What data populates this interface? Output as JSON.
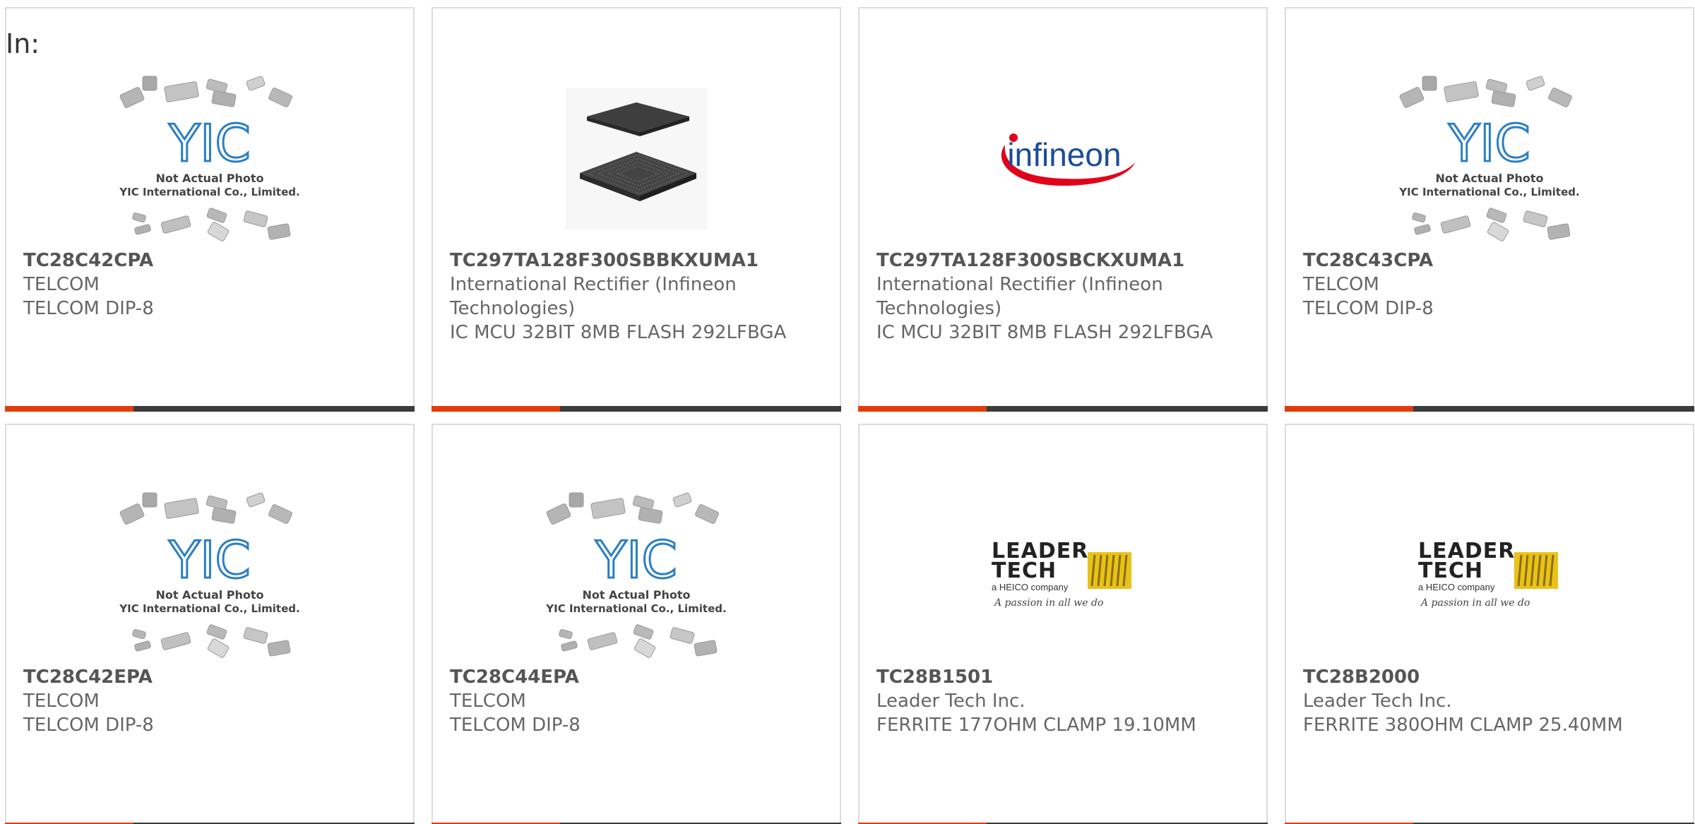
{
  "filter": {
    "label": "In:"
  },
  "colors": {
    "accent": "#e63a0a",
    "bar_dark": "#3b3b3b",
    "border": "#dcdcdc",
    "yic_blue": "#2a7fc4",
    "infineon_red": "#e2001a",
    "infineon_blue": "#1b4b9b",
    "leader_yellow": "#e8c21a"
  },
  "placeholder_logo": {
    "brand": "YIC",
    "line1": "Not Actual Photo",
    "line2": "YIC International Co., Limited."
  },
  "infineon_logo": {
    "text": "infineon"
  },
  "leader_logo": {
    "line1": "LEADER",
    "line2": "TECH",
    "line3": "a HEICO company",
    "tagline": "A passion in all we do"
  },
  "products": [
    {
      "part_number": "TC28C42CPA",
      "manufacturer": "TELCOM",
      "description": "TELCOM DIP-8",
      "image": "yic-placeholder"
    },
    {
      "part_number": "TC297TA128F300SBBKXUMA1",
      "manufacturer": "International Rectifier (Infineon Technologies)",
      "description": "IC MCU 32BIT 8MB FLASH 292LFBGA",
      "image": "bga-chip"
    },
    {
      "part_number": "TC297TA128F300SBCKXUMA1",
      "manufacturer": "International Rectifier (Infineon Technologies)",
      "description": "IC MCU 32BIT 8MB FLASH 292LFBGA",
      "image": "infineon-logo"
    },
    {
      "part_number": "TC28C43CPA",
      "manufacturer": "TELCOM",
      "description": "TELCOM DIP-8",
      "image": "yic-placeholder"
    },
    {
      "part_number": "TC28C42EPA",
      "manufacturer": "TELCOM",
      "description": "TELCOM DIP-8",
      "image": "yic-placeholder"
    },
    {
      "part_number": "TC28C44EPA",
      "manufacturer": "TELCOM",
      "description": "TELCOM DIP-8",
      "image": "yic-placeholder"
    },
    {
      "part_number": "TC28B1501",
      "manufacturer": "Leader Tech Inc.",
      "description": "FERRITE 177OHM CLAMP 19.10MM",
      "image": "leader-tech-logo"
    },
    {
      "part_number": "TC28B2000",
      "manufacturer": "Leader Tech Inc.",
      "description": "FERRITE 380OHM CLAMP 25.40MM",
      "image": "leader-tech-logo"
    }
  ]
}
